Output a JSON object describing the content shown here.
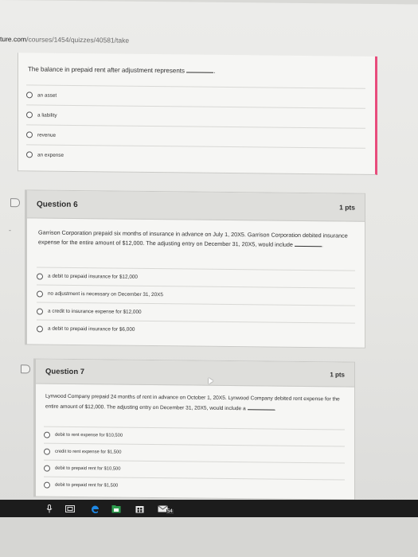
{
  "url": {
    "host": "ture.com",
    "path": "/courses/1454/quizzes/40581/take"
  },
  "q5": {
    "text": "The balance in prepaid rent after adjustment represents",
    "tail": ".",
    "answers": [
      "an asset",
      "a liability",
      "revenue",
      "an expense"
    ]
  },
  "q6": {
    "title": "Question 6",
    "points": "1 pts",
    "text": "Garrison Corporation prepaid six months of insurance in advance on July 1, 20X5. Garrison Corporation debited insurance expense for the entire amount of $12,000. The adjusting entry on December 31, 20X5, would include",
    "tail": ".",
    "answers": [
      "a debit to prepaid insurance for $12,000",
      "no adjustment is necessary on December 31, 20X5",
      "a credit to insurance expense for $12,000",
      "a debit to prepaid insurance for $6,000"
    ]
  },
  "q7": {
    "title": "Question 7",
    "points": "1 pts",
    "text": "Lynwood Company prepaid 24 months of rent in advance on October 1, 20X5. Lynwood Company debited rent expense for the entire amount of $12,000. The adjusting entry on December 31, 20X5, would include a",
    "tail": ".",
    "answers": [
      "debit to rent expense for $10,500",
      "credit to rent expense for $1,500",
      "debit to prepaid rent for $10,500",
      "debit to prepaid rent for $1,500"
    ]
  },
  "taskbar": {
    "badge": "54",
    "icons": [
      "microphone-icon",
      "task-view-icon",
      "edge-icon",
      "file-explorer-icon",
      "store-icon",
      "mail-icon"
    ]
  },
  "colors": {
    "accent_border": "#e84c7c",
    "edge_blue": "#1e88e5",
    "store_green": "#2e9e4f"
  }
}
